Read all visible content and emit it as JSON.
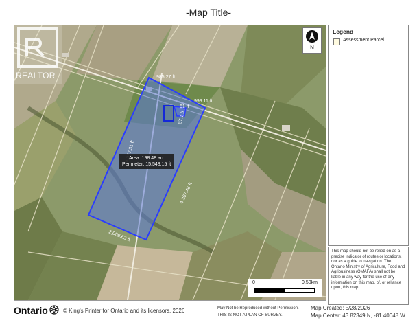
{
  "map": {
    "title": "-Map Title-",
    "north_label": "N",
    "area_label": "Area: 198.48 ac",
    "perimeter_label": "Perimeter: 15,548.15 ft",
    "scale_start": "0",
    "scale_end": "0.50km",
    "dimensions": {
      "top": "985.27 ft",
      "top_right": "999.11 ft",
      "inner_top": "61 ft",
      "inner_side": "87.1 ft",
      "left": "4,377.31 ft",
      "right": "4,307.46 ft",
      "bottom": "2,008.63 ft"
    },
    "colors": {
      "parcel_stroke": "#2a3cff",
      "parcel_fill": "#5a78d8"
    }
  },
  "legend": {
    "title": "Legend",
    "items": [
      {
        "label": "Assessment Parcel"
      }
    ]
  },
  "disclaimer": "This map should not be relied on as a precise indicator of routes or locations, nor as a guide to navigation. The Ontario Ministry of Agriculture, Food and Agribusiness (OMAFA) shall not be liable in any way for the use of any information on this map. of, or reliance upon, this map.",
  "watermark": "REALTOR",
  "footer": {
    "logo": "Ontario",
    "copyright": "© King's Printer for Ontario and its licensors, 2026",
    "not_reproduced": "May Not be Reproduced without Permission.",
    "not_survey": "THIS IS NOT A PLAN OF SURVEY.",
    "created": "Map Created: 5/28/2026",
    "center": "Map Center: 43.82349 N, -81.40048 W"
  }
}
